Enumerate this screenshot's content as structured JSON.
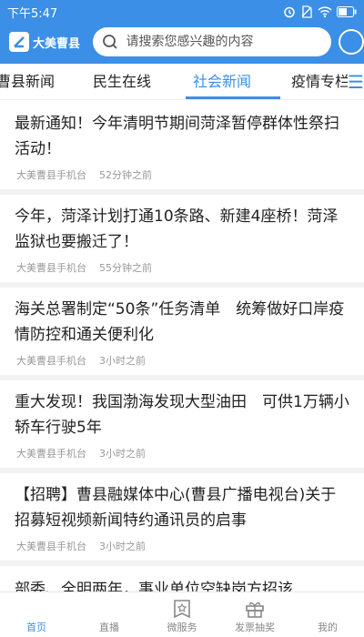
{
  "status_bar": {
    "time": "下午5:47"
  },
  "header": {
    "brand_name": "大美曹县",
    "search_placeholder": "请搜索您感兴趣的内容"
  },
  "tabs": [
    {
      "label": "曹县新闻",
      "active": false
    },
    {
      "label": "民生在线",
      "active": false
    },
    {
      "label": "社会新闻",
      "active": true
    },
    {
      "label": "疫情专栏",
      "active": false
    }
  ],
  "news": [
    {
      "title": "最新通知！今年清明节期间菏泽暂停群体性祭扫活动！",
      "source": "大美曹县手机台",
      "time": "52分钟之前"
    },
    {
      "title": "今年，菏泽计划打通10条路、新建4座桥！菏泽监狱也要搬迁了！",
      "source": "大美曹县手机台",
      "time": "55分钟之前"
    },
    {
      "title": "海关总署制定“50条”任务清单　统筹做好口岸疫情防控和通关便利化",
      "source": "大美曹县手机台",
      "time": "3小时之前"
    },
    {
      "title": "重大发现！我国渤海发现大型油田　可供1万辆小轿车行驶5年",
      "source": "大美曹县手机台",
      "time": "3小时之前"
    },
    {
      "title": "【招聘】曹县融媒体中心(曹县广播电视台)关于招募短视频新闻特约通讯员的启事",
      "source": "大美曹县手机台",
      "time": "3小时之前"
    },
    {
      "title": "部委、全明两年，事业单位空缺岗方招该",
      "source": "",
      "time": ""
    }
  ],
  "bottom_nav": [
    {
      "label": "首页",
      "icon": "home-icon",
      "active": true
    },
    {
      "label": "直播",
      "icon": "live-icon",
      "active": false
    },
    {
      "label": "微服务",
      "icon": "service-icon",
      "active": false
    },
    {
      "label": "发票抽奖",
      "icon": "gift-icon",
      "active": false
    },
    {
      "label": "我的",
      "icon": "user-icon",
      "active": false
    }
  ],
  "colors": {
    "brand_blue": "#3b8fe6",
    "meta_gray": "#999999"
  }
}
